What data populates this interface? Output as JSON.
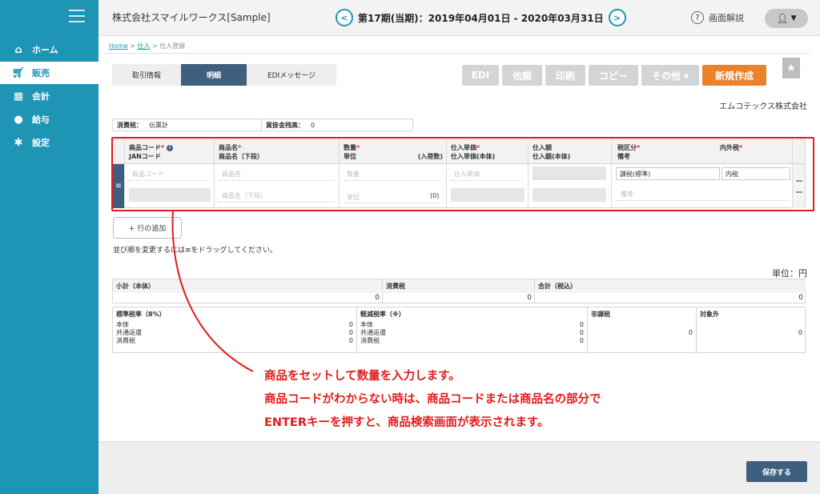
{
  "sidebar": {
    "items": [
      {
        "label": "ホーム",
        "icon": "home-icon"
      },
      {
        "label": "販売",
        "icon": "cart-icon"
      },
      {
        "label": "会計",
        "icon": "calculator-icon"
      },
      {
        "label": "給与",
        "icon": "money-bag-icon"
      },
      {
        "label": "設定",
        "icon": "gear-icon"
      }
    ],
    "active_index": 1
  },
  "header": {
    "company": "株式会社スマイルワークス[Sample]",
    "period": "第17期(当期)：2019年04月01日 - 2020年03月31日",
    "help_label": "画面解説",
    "user_caret": "▼"
  },
  "breadcrumb": {
    "home": "Home",
    "sep": " > ",
    "mid": "仕入",
    "current": "仕入登録"
  },
  "tabs": [
    "取引情報",
    "明細",
    "EDIメッセージ"
  ],
  "active_tab": 1,
  "toolbar": {
    "edi": "EDI",
    "request": "依頼",
    "print": "印刷",
    "copy": "コピー",
    "other": "その他 ▾",
    "new": "新規作成"
  },
  "supplier_name": "エムコテックス株式会社",
  "info_bar": {
    "tax_label": "消費税：",
    "tax_value": "伝票計",
    "balance_label": "買掛金残高：",
    "balance_value": "0"
  },
  "detail": {
    "headers": {
      "code": "商品コード",
      "jan": "JANコード",
      "name": "商品名",
      "name_sub": "商品名（下段）",
      "qty": "数量",
      "unit": "単位",
      "pack": "(入荷数)",
      "price": "仕入単価",
      "price_body": "仕入単価(本体)",
      "amount": "仕入額",
      "amount_body": "仕入額(本体)",
      "tax_cat": "税区分",
      "memo": "備考",
      "incl": "内外税"
    },
    "placeholders": {
      "code": "商品コード",
      "name": "商品名",
      "name_sub": "商品名（下段）",
      "qty": "数量",
      "unit": "単位",
      "price": "仕入単価",
      "memo": "備考"
    },
    "pack_value": "(0)",
    "tax_cat_value": "課税(標準)",
    "incl_value": "内税"
  },
  "add_row_label": "+ 行の追加",
  "drag_note": "並び順を変更するには≡をドラッグしてください。",
  "unit_label": "単位：円",
  "totals": {
    "subtotal_label": "小計（本体）",
    "subtotal": "0",
    "tax_label": "消費税",
    "tax": "0",
    "total_label": "合計（税込）",
    "total": "0"
  },
  "breakdown": {
    "std": {
      "title": "標準税率（8%）",
      "rows": [
        [
          "本体",
          "0"
        ],
        [
          "共通返還",
          "0"
        ],
        [
          "消費税",
          "0"
        ]
      ]
    },
    "reduced": {
      "title": "軽減税率（※）",
      "rows": [
        [
          "本体",
          "0"
        ],
        [
          "共通返還",
          "0"
        ],
        [
          "消費税",
          "0"
        ]
      ]
    },
    "nontax": {
      "title": "非課税",
      "value": "0"
    },
    "exempt": {
      "title": "対象外",
      "value": "0"
    }
  },
  "callout": {
    "line1": "商品をセットして数量を入力します。",
    "line2": "商品コードがわからない時は、商品コードまたは商品名の部分で",
    "line3": "ENTERキーを押すと、商品検索画面が表示されます。",
    "color": "#e31c1c"
  },
  "save_label": "保存する"
}
